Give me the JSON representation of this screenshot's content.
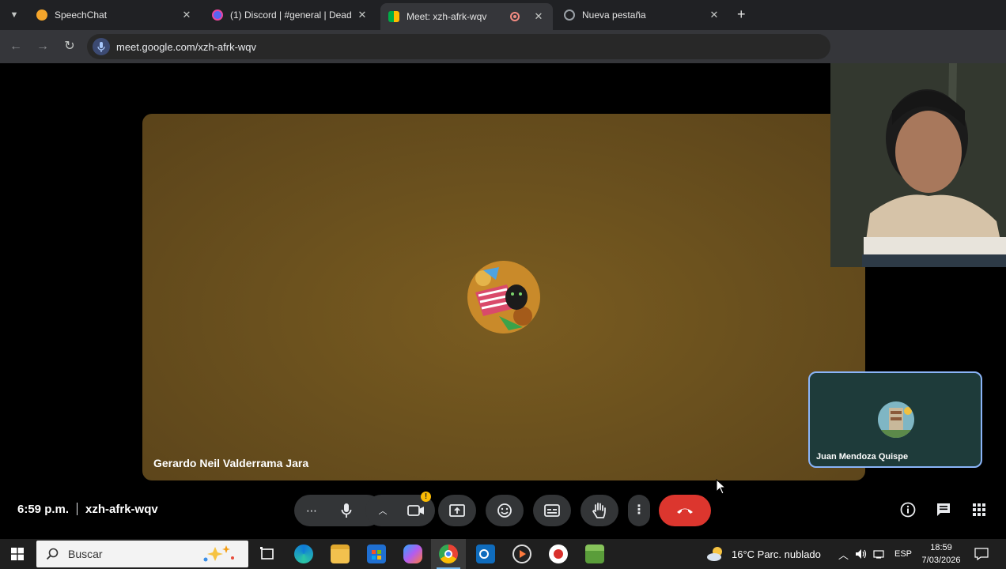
{
  "browser": {
    "tabs": [
      {
        "title": "SpeechChat",
        "favicon_color": "#f4a52b"
      },
      {
        "title": "(1) Discord | #general | Dead an",
        "favicon_color": "#5865f2"
      },
      {
        "title": "Meet: xzh-afrk-wqv",
        "favicon_color": "#00ac47",
        "active": true
      },
      {
        "title": "Nueva pestaña",
        "favicon_color": "#9aa0a6"
      }
    ],
    "url": "meet.google.com/xzh-afrk-wqv"
  },
  "meet": {
    "main_participant": {
      "name": "Gerardo Neil Valderrama Jara"
    },
    "pip_participant": {
      "name": "Juan Mendoza Quispe"
    },
    "time": "6:59 p.m.",
    "meeting_code": "xzh-afrk-wqv",
    "camera_warning": "!"
  },
  "taskbar": {
    "search_placeholder": "Buscar",
    "weather": "16°C  Parc. nublado",
    "language": "ESP",
    "time": "18:59",
    "date": "7/03/2026"
  }
}
